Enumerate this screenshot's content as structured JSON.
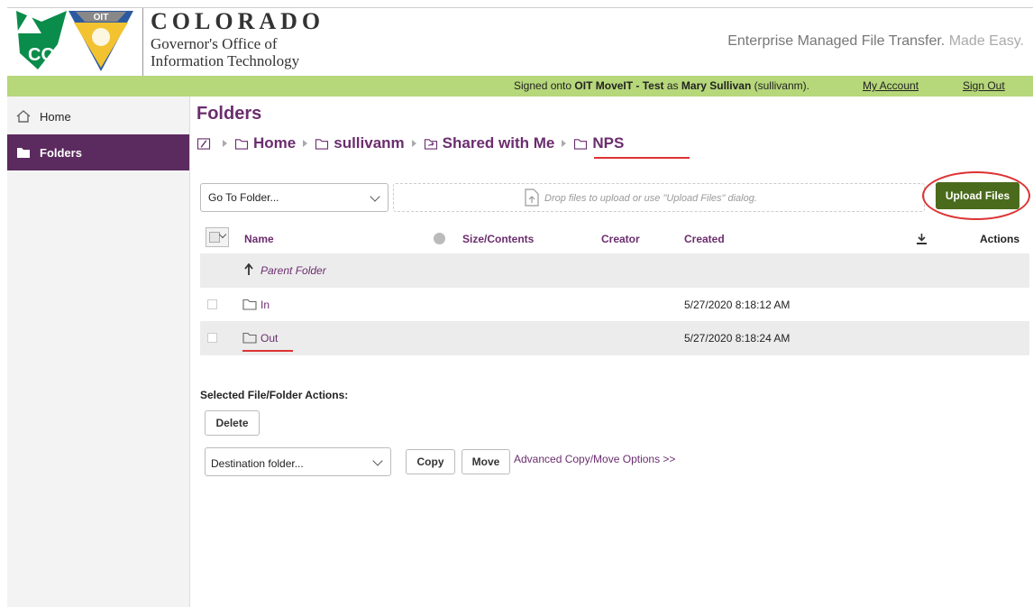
{
  "header": {
    "logo_top": "OIT",
    "logo_bottom": "CO",
    "brand_name": "COLORADO",
    "brand_line1": "Governor's Office of",
    "brand_line2": "Information Technology",
    "tagline_main": "Enterprise Managed File Transfer.",
    "tagline_light": "Made Easy."
  },
  "topbar": {
    "signed_prefix": "Signed onto",
    "site": "OIT MoveIT - Test",
    "as": "as",
    "user_name": "Mary Sullivan",
    "user_id": "(sullivanm).",
    "my_account": "My Account",
    "sign_out": "Sign Out"
  },
  "sidebar": {
    "items": [
      {
        "label": "Home",
        "icon": "home-icon",
        "active": false
      },
      {
        "label": "Folders",
        "icon": "folder-icon",
        "active": true
      }
    ]
  },
  "main": {
    "title": "Folders",
    "breadcrumb": [
      "Home",
      "sullivanm",
      "Shared with Me",
      "NPS"
    ],
    "goto_folder": "Go To Folder...",
    "drop_text": "Drop files to upload or use \"Upload Files\" dialog.",
    "upload_button": "Upload Files"
  },
  "table": {
    "columns": {
      "name": "Name",
      "size": "Size/Contents",
      "creator": "Creator",
      "created": "Created",
      "actions": "Actions"
    },
    "parent_folder": "Parent Folder",
    "rows": [
      {
        "name": "In",
        "created": "5/27/2020 8:18:12 AM"
      },
      {
        "name": "Out",
        "created": "5/27/2020 8:18:24 AM"
      }
    ]
  },
  "actions": {
    "section_label": "Selected File/Folder Actions:",
    "delete": "Delete",
    "destination_placeholder": "Destination folder...",
    "copy": "Copy",
    "move": "Move",
    "advanced_link": "Advanced Copy/Move Options >>"
  },
  "colors": {
    "brand_purple": "#6b2d6e",
    "topbar_green": "#b6d77a",
    "upload_green": "#4a6b1c",
    "sidebar_active": "#5b2a5e",
    "annotation_red": "#dd3333"
  }
}
